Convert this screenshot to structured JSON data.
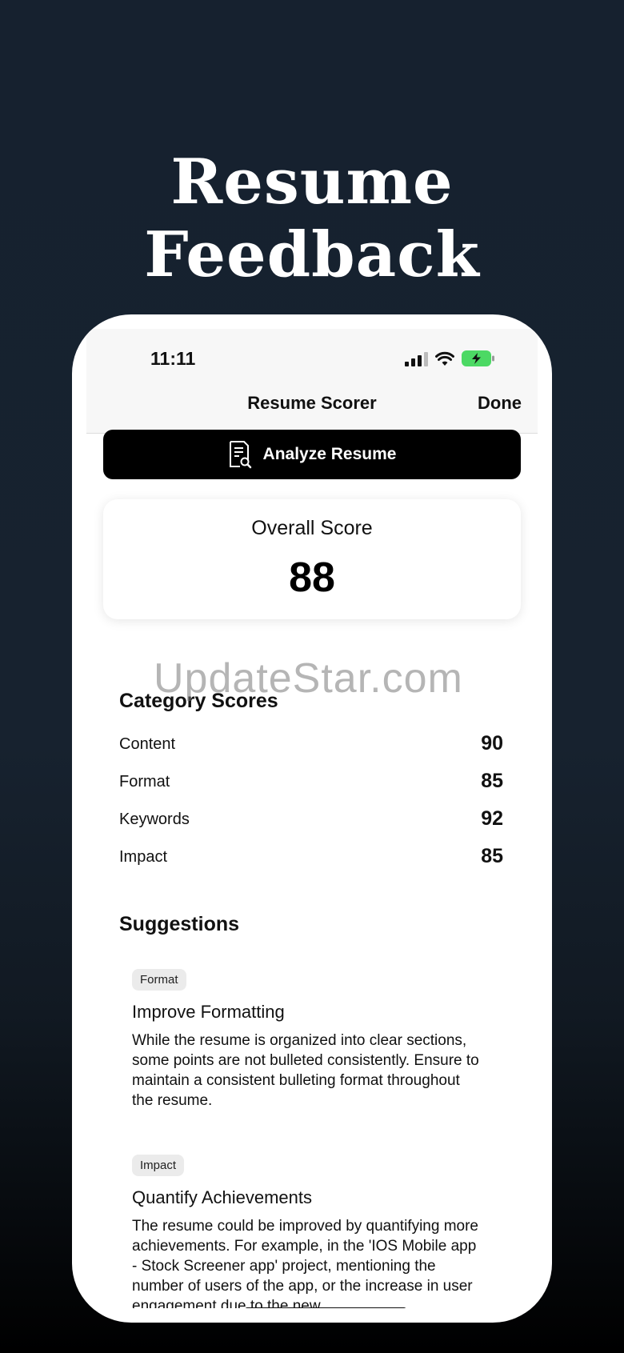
{
  "headline": "Resume Feedback",
  "status_bar": {
    "time": "11:11",
    "icons": [
      "cellular-signal-icon",
      "wifi-icon",
      "battery-charging-icon"
    ]
  },
  "nav": {
    "title": "Resume Scorer",
    "done_label": "Done"
  },
  "analyze_button": {
    "label": "Analyze Resume",
    "icon": "document-search-icon"
  },
  "overall": {
    "label": "Overall Score",
    "value": "88"
  },
  "categories": {
    "title": "Category Scores",
    "items": [
      {
        "name": "Content",
        "score": "90"
      },
      {
        "name": "Format",
        "score": "85"
      },
      {
        "name": "Keywords",
        "score": "92"
      },
      {
        "name": "Impact",
        "score": "85"
      }
    ]
  },
  "suggestions": {
    "title": "Suggestions",
    "items": [
      {
        "tag": "Format",
        "title": "Improve Formatting",
        "body": "While the resume is organized into clear sections, some points are not bulleted consistently. Ensure to maintain a consistent bulleting format throughout the resume."
      },
      {
        "tag": "Impact",
        "title": "Quantify Achievements",
        "body": "The resume could be improved by quantifying more achievements. For example, in the 'IOS Mobile app - Stock Screener app' project, mentioning the number of users of the app, or the increase in user engagement due to the new"
      }
    ]
  },
  "watermark": "UpdateStar.com",
  "colors": {
    "background": "#16212f",
    "button": "#000000",
    "battery": "#4cd964"
  }
}
